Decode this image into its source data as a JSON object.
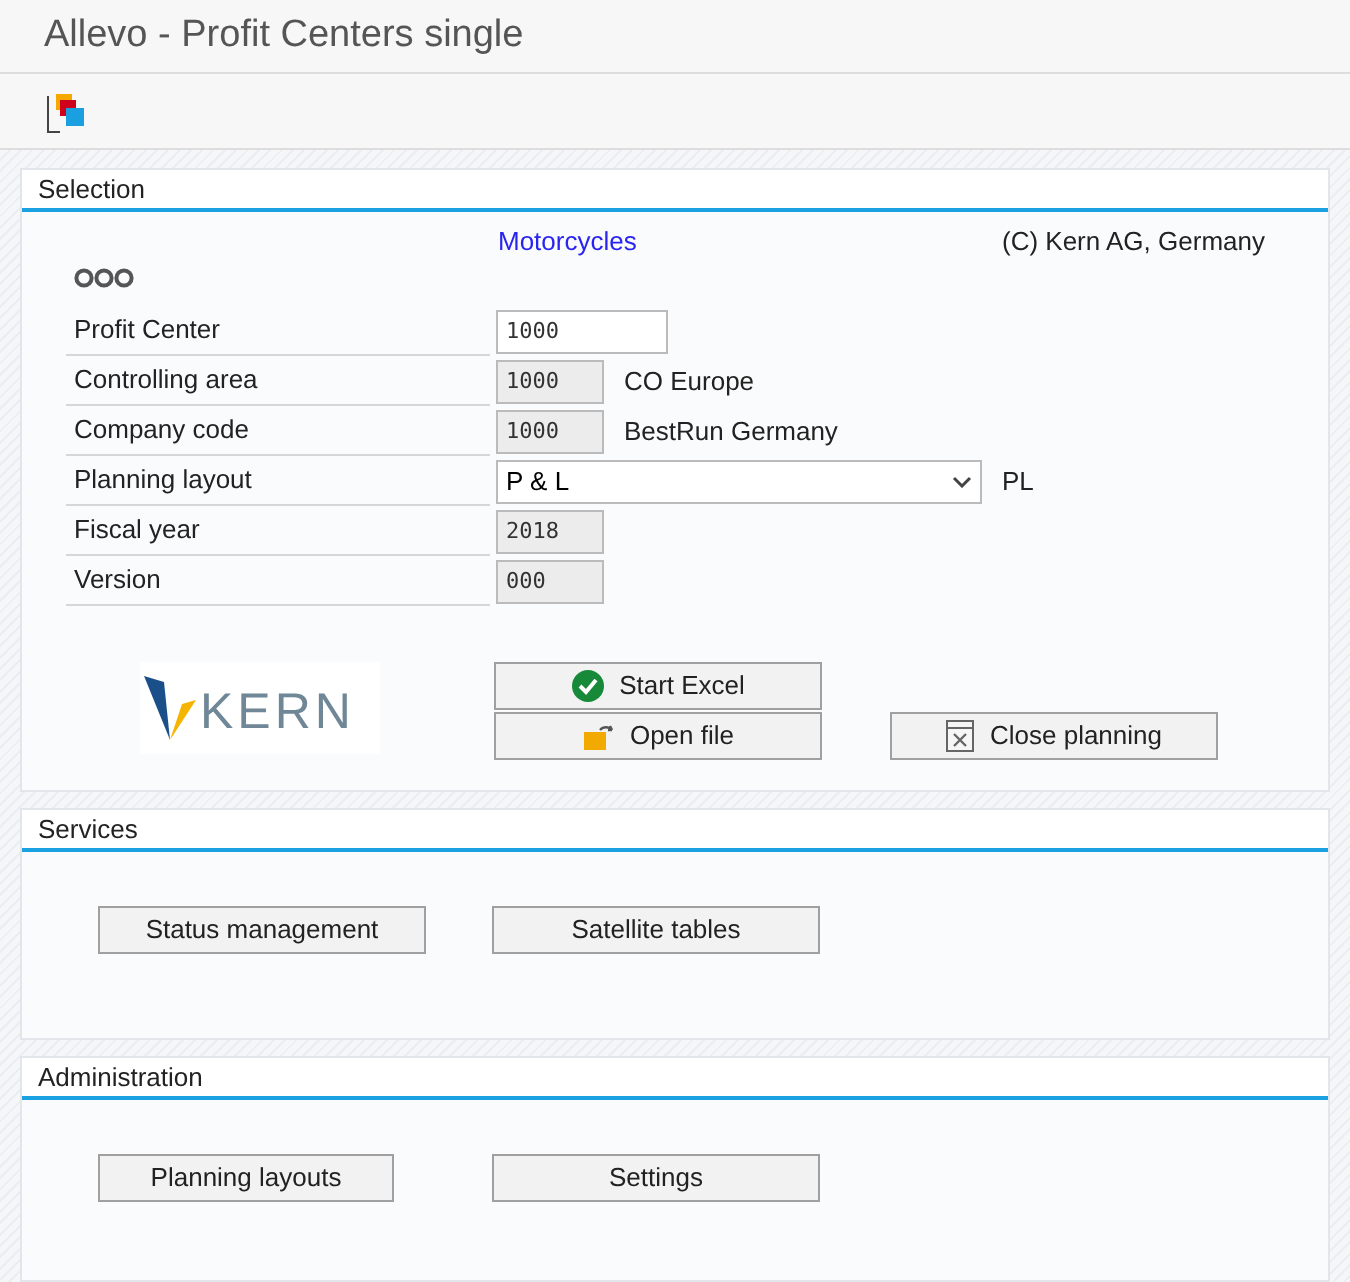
{
  "window": {
    "title": "Allevo - Profit Centers single"
  },
  "selection": {
    "title": "Selection",
    "link": "Motorcycles",
    "copyright": "(C) Kern AG, Germany",
    "fields": [
      {
        "label": "Profit Center",
        "kind": "input",
        "value": "1000",
        "disabled": false
      },
      {
        "label": "Controlling area",
        "kind": "input",
        "value": "1000",
        "disabled": true,
        "description": "CO Europe"
      },
      {
        "label": "Company code",
        "kind": "input",
        "value": "1000",
        "disabled": true,
        "description": "BestRun Germany"
      },
      {
        "label": "Planning layout",
        "kind": "dropdown",
        "value": "P & L",
        "disabled": false,
        "description": "PL"
      },
      {
        "label": "Fiscal year",
        "kind": "input",
        "value": "2018",
        "disabled": true
      },
      {
        "label": "Version",
        "kind": "input",
        "value": "000",
        "disabled": true
      }
    ],
    "logo": "KERN",
    "buttons": [
      {
        "label": "Start Excel",
        "kind": "check"
      },
      {
        "label": "Open file",
        "kind": "folder"
      },
      {
        "label": "Close planning",
        "kind": "close"
      }
    ]
  },
  "services": {
    "title": "Services",
    "buttons": [
      "Status management",
      "Satellite tables"
    ]
  },
  "administration": {
    "title": "Administration",
    "buttons": [
      "Planning layouts",
      "Settings"
    ]
  }
}
